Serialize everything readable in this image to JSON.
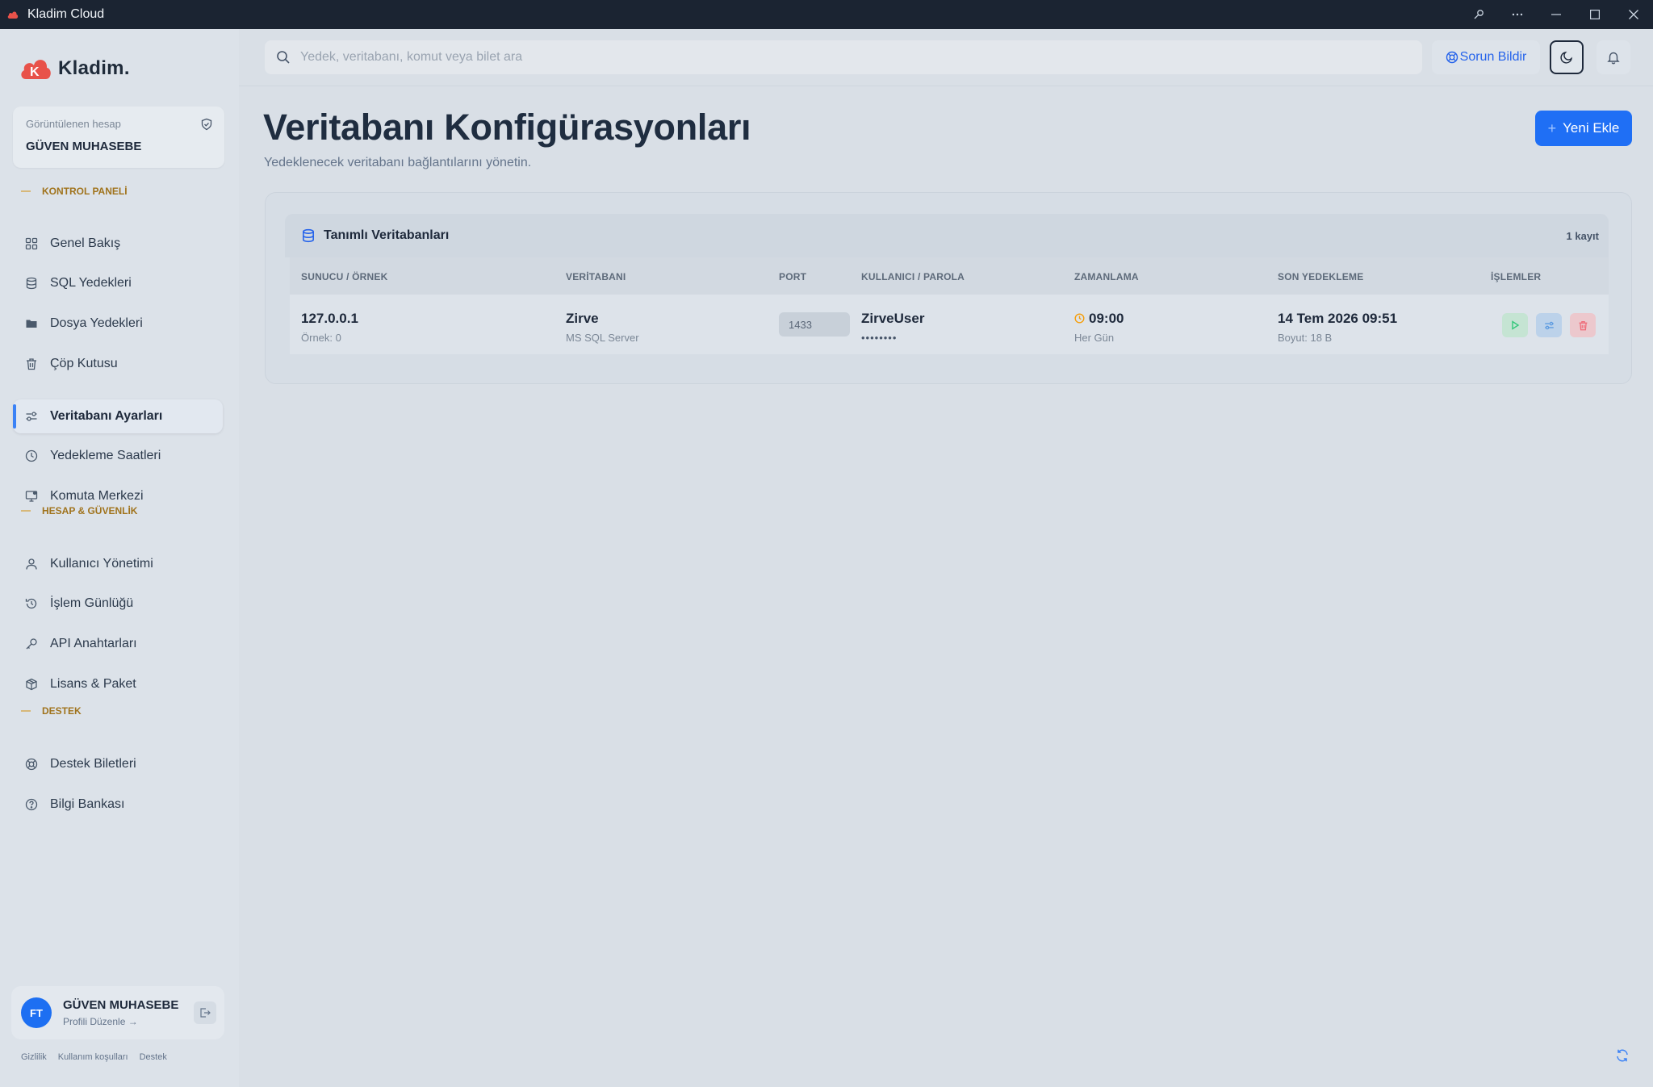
{
  "window": {
    "title": "Kladim Cloud"
  },
  "brand": {
    "name": "Kladim.",
    "accent": "#1f6ff5",
    "logo_color": "#e8524a"
  },
  "account": {
    "label": "Görüntülenen hesap",
    "name": "GÜVEN MUHASEBE"
  },
  "sections": {
    "control": "KONTROL PANELİ",
    "account_security": "HESAP & GÜVENLİK",
    "support": "DESTEK"
  },
  "nav": {
    "overview": "Genel Bakış",
    "sql_backups": "SQL Yedekleri",
    "file_backups": "Dosya Yedekleri",
    "trash": "Çöp Kutusu",
    "db_settings": "Veritabanı Ayarları",
    "schedules": "Yedekleme Saatleri",
    "command_center": "Komuta Merkezi",
    "users": "Kullanıcı Yönetimi",
    "activity_log": "İşlem Günlüğü",
    "api_keys": "API Anahtarları",
    "license": "Lisans & Paket",
    "tickets": "Destek Biletleri",
    "knowledge_base": "Bilgi Bankası"
  },
  "user": {
    "initials": "FT",
    "name": "GÜVEN MUHASEBE",
    "edit_link": "Profili Düzenle →"
  },
  "footer": {
    "privacy": "Gizlilik",
    "terms": "Kullanım koşulları",
    "support": "Destek"
  },
  "topbar": {
    "search_placeholder": "Yedek, veritabanı, komut veya bilet ara",
    "report_button": "Sorun Bildir"
  },
  "page": {
    "title": "Veritabanı Konfigürasyonları",
    "subtitle": "Yedeklenecek veritabanı bağlantılarını yönetin.",
    "add_button": "Yeni Ekle"
  },
  "panel": {
    "title": "Tanımlı Veritabanları",
    "count": "1 kayıt",
    "columns": [
      "SUNUCU / ÖRNEK",
      "VERİTABANI",
      "PORT",
      "KULLANICI / PAROLA",
      "ZAMANLAMA",
      "SON YEDEKLEME",
      "İŞLEMLER"
    ],
    "rows": [
      {
        "server": "127.0.0.1",
        "instance": "Örnek: 0",
        "database": "Zirve",
        "engine": "MS SQL Server",
        "port": "1433",
        "user": "ZirveUser",
        "password": "••••••••",
        "time": "09:00",
        "frequency": "Her Gün",
        "last_backup": "14 Tem 2026 09:51",
        "size": "Boyut: 18 B"
      }
    ]
  }
}
